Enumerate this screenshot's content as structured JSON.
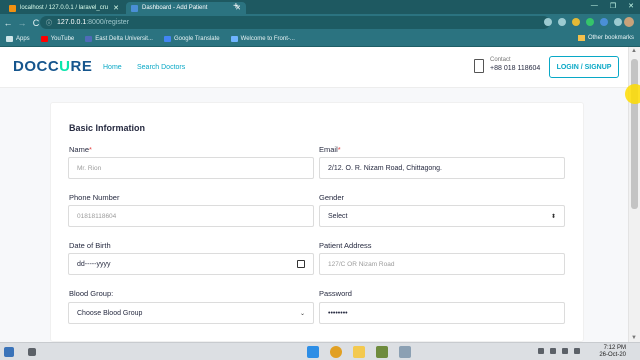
{
  "browser": {
    "tabs": [
      {
        "title": "localhost / 127.0.0.1 / laravel_cru",
        "active": false
      },
      {
        "title": "Dashboard - Add Patient",
        "active": true
      }
    ],
    "new_tab": "+",
    "url_host": "127.0.0.1",
    "url_path": ":8000/register",
    "nav": {
      "back": "←",
      "forward": "→",
      "reload": "C"
    },
    "bookmarks": [
      "Apps",
      "YouTube",
      "East Delta Universit...",
      "Google Translate",
      "Welcome to Front-..."
    ],
    "other_bookmarks": "Other bookmarks",
    "window_controls": [
      "—",
      "❐",
      "✕"
    ]
  },
  "site": {
    "logo_main": "DOCC",
    "logo_accent": "U",
    "logo_end": "RE",
    "nav": [
      "Home",
      "Search Doctors"
    ],
    "contact_label": "Contact",
    "contact_number": "+88 018 118604",
    "login_label": "LOGIN / SIGNUP"
  },
  "form": {
    "title": "Basic Information",
    "name_label": "Name",
    "name_placeholder": "Mr. Rion",
    "email_label": "Email",
    "email_value": "2/12. O. R. Nizam Road, Chittagong.",
    "phone_label": "Phone Number",
    "phone_placeholder": "01818118604",
    "gender_label": "Gender",
    "gender_value": "Select",
    "dob_label": "Date of Birth",
    "dob_value": "dd-----yyyy",
    "address_label": "Patient Address",
    "address_placeholder": "127/C OR Nizam Road",
    "blood_label": "Blood Group:",
    "blood_value": "Choose Blood Group",
    "password_label": "Password",
    "password_value": "••••••••",
    "required_mark": "*"
  },
  "taskbar": {
    "time": "7:12 PM",
    "date": "26-Oct-20"
  },
  "colors": {
    "chrome_dark": "#1e5961",
    "chrome": "#2b7380",
    "brand_blue": "#15558d",
    "brand_green": "#09e5ab",
    "link": "#09a8c6"
  }
}
